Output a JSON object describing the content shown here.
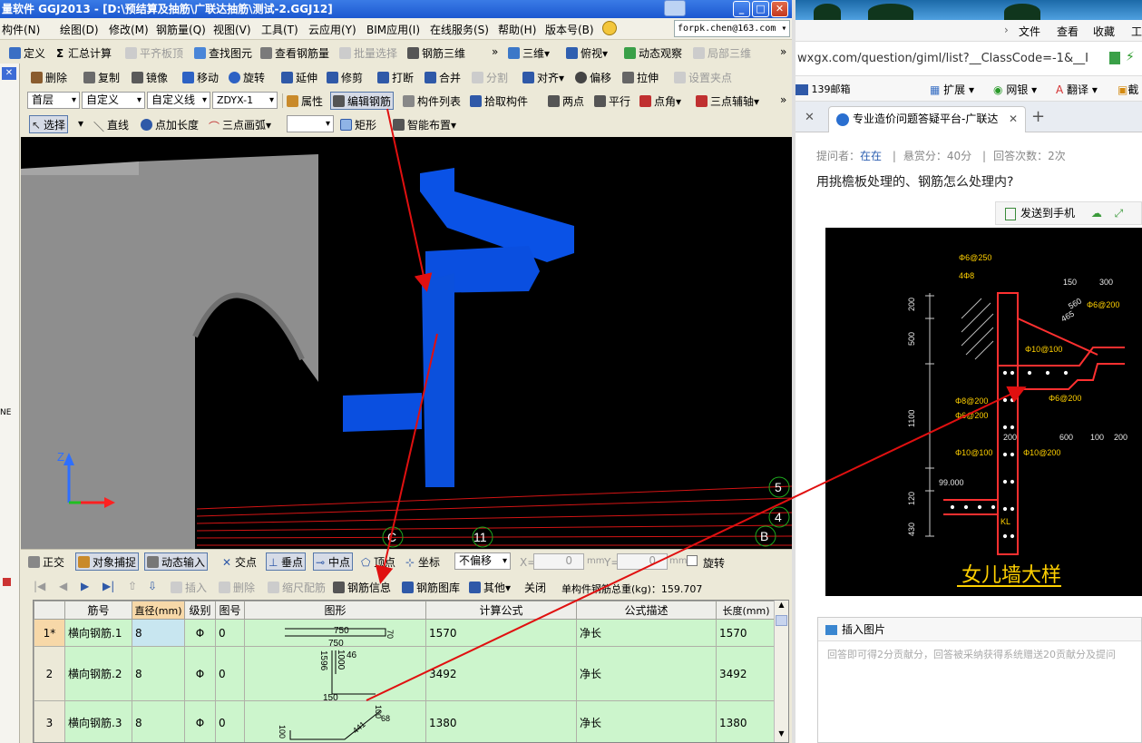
{
  "app": {
    "title": "量软件 GGJ2013 - [D:\\预结算及抽筋\\广联达抽筋\\测试-2.GGJ12]",
    "user": "forpk.chen@163.com",
    "window_buttons": [
      "_",
      "□",
      "✕"
    ]
  },
  "menubar": [
    "构件(N)",
    "绘图(D)",
    "修改(M)",
    "钢筋量(Q)",
    "视图(V)",
    "工具(T)",
    "云应用(Y)",
    "BIM应用(I)",
    "在线服务(S)",
    "帮助(H)",
    "版本号(B)"
  ],
  "toolbar1": {
    "items": [
      "定义",
      "汇总计算",
      "平齐板顶",
      "查找图元",
      "查看钢筋量",
      "批量选择",
      "钢筋三维",
      "三维",
      "俯视",
      "动态观察",
      "局部三维"
    ],
    "disabled": [
      "平齐板顶",
      "批量选择",
      "局部三维"
    ]
  },
  "toolbar2": {
    "items": [
      "删除",
      "复制",
      "镜像",
      "移动",
      "旋转",
      "延伸",
      "修剪",
      "打断",
      "合并",
      "分割",
      "对齐",
      "偏移",
      "拉伸",
      "设置夹点"
    ],
    "disabled": [
      "分割",
      "设置夹点"
    ]
  },
  "toolbar3": {
    "selects": [
      "首层",
      "自定义",
      "自定义线",
      "ZDYX-1"
    ],
    "items": [
      "属性",
      "编辑钢筋",
      "构件列表",
      "拾取构件",
      "两点",
      "平行",
      "点角",
      "三点辅轴"
    ]
  },
  "toolbar4": {
    "items": [
      "选择",
      "直线",
      "点加长度",
      "三点画弧",
      "矩形",
      "智能布置"
    ]
  },
  "left_strip": {
    "close_label": "✕",
    "label": "NE"
  },
  "viewport": {
    "axis_labels": {
      "z": "Z"
    },
    "grid_markers": [
      "5",
      "4",
      "B",
      "C",
      "11"
    ]
  },
  "statusbar": {
    "items": [
      "正交",
      "对象捕捉",
      "动态输入",
      "交点",
      "垂点",
      "中点",
      "顶点",
      "坐标"
    ],
    "offset_select": "不偏移",
    "x_label": "X=",
    "x_value": "0",
    "y_label": "Y=",
    "y_value": "0",
    "unit": "mm",
    "rotate_label": "旋转"
  },
  "rebar_toolbar": {
    "items": [
      "插入",
      "删除",
      "缩尺配筋",
      "钢筋信息",
      "钢筋图库",
      "其他",
      "关闭"
    ],
    "disabled": [
      "插入",
      "删除",
      "缩尺配筋"
    ],
    "total_weight": "单构件钢筋总重(kg)：159.707"
  },
  "rebar_table": {
    "columns": [
      "",
      "筋号",
      "直径(mm)",
      "级别",
      "图号",
      "图形",
      "计算公式",
      "公式描述",
      "长度(mm)"
    ],
    "rows": [
      {
        "num": "1*",
        "name": "横向钢筋.1",
        "diameter": "8",
        "grade": "Φ",
        "fig": "0",
        "formula": "1570",
        "desc": "净长",
        "length": "1570",
        "shape_labels": [
          "750",
          "750",
          "70"
        ]
      },
      {
        "num": "2",
        "name": "横向钢筋.2",
        "diameter": "8",
        "grade": "Φ",
        "fig": "0",
        "formula": "3492",
        "desc": "净长",
        "length": "3492",
        "shape_labels": [
          "1596",
          "1000",
          "46",
          "150"
        ]
      },
      {
        "num": "3",
        "name": "横向钢筋.3",
        "diameter": "8",
        "grade": "Φ",
        "fig": "0",
        "formula": "1380",
        "desc": "净长",
        "length": "1380",
        "shape_labels": [
          "100",
          "441",
          "100",
          "68"
        ]
      }
    ]
  },
  "browser": {
    "menu": [
      "文件",
      "查看",
      "收藏",
      "工"
    ],
    "address": "wxgx.com/question/giml/list?__ClassCode=-1&__I",
    "bookmarks": [
      "139邮箱",
      "扩展",
      "网银",
      "翻译",
      "截"
    ],
    "tab_title": "专业造价问题答疑平台-广联达",
    "tab_close": "✕",
    "tab_new": "+"
  },
  "question": {
    "asker_label": "提问者：",
    "asker": "在在",
    "reward": "悬赏分：40分",
    "answers": "回答次数：2次",
    "title": "用挑檐板处理的、钢筋怎么处理内?",
    "send_label": "发送到手机"
  },
  "cad_drawing": {
    "title": "女儿墙大样",
    "labels": [
      "Φ6@250",
      "4Φ8",
      "Φ6@200",
      "Φ10@100",
      "Φ8@200",
      "Φ6@200",
      "Φ6@200",
      "Φ10@100",
      "Φ10@200",
      "150",
      "300",
      "200",
      "500",
      "1100",
      "120",
      "430",
      "200",
      "600",
      "100",
      "200",
      "99.000",
      "KL",
      "560",
      "465"
    ]
  },
  "answer_box": {
    "insert_label": "插入图片",
    "placeholder": "回答即可得2分贡献分，回答被采纳获得系统赠送20贡献分及提问"
  },
  "colors": {
    "titlebar": "#1c58d0",
    "member_blue": "#0a4fe0",
    "row_green": "#ccf5cc",
    "annotation_red": "#e01010"
  }
}
